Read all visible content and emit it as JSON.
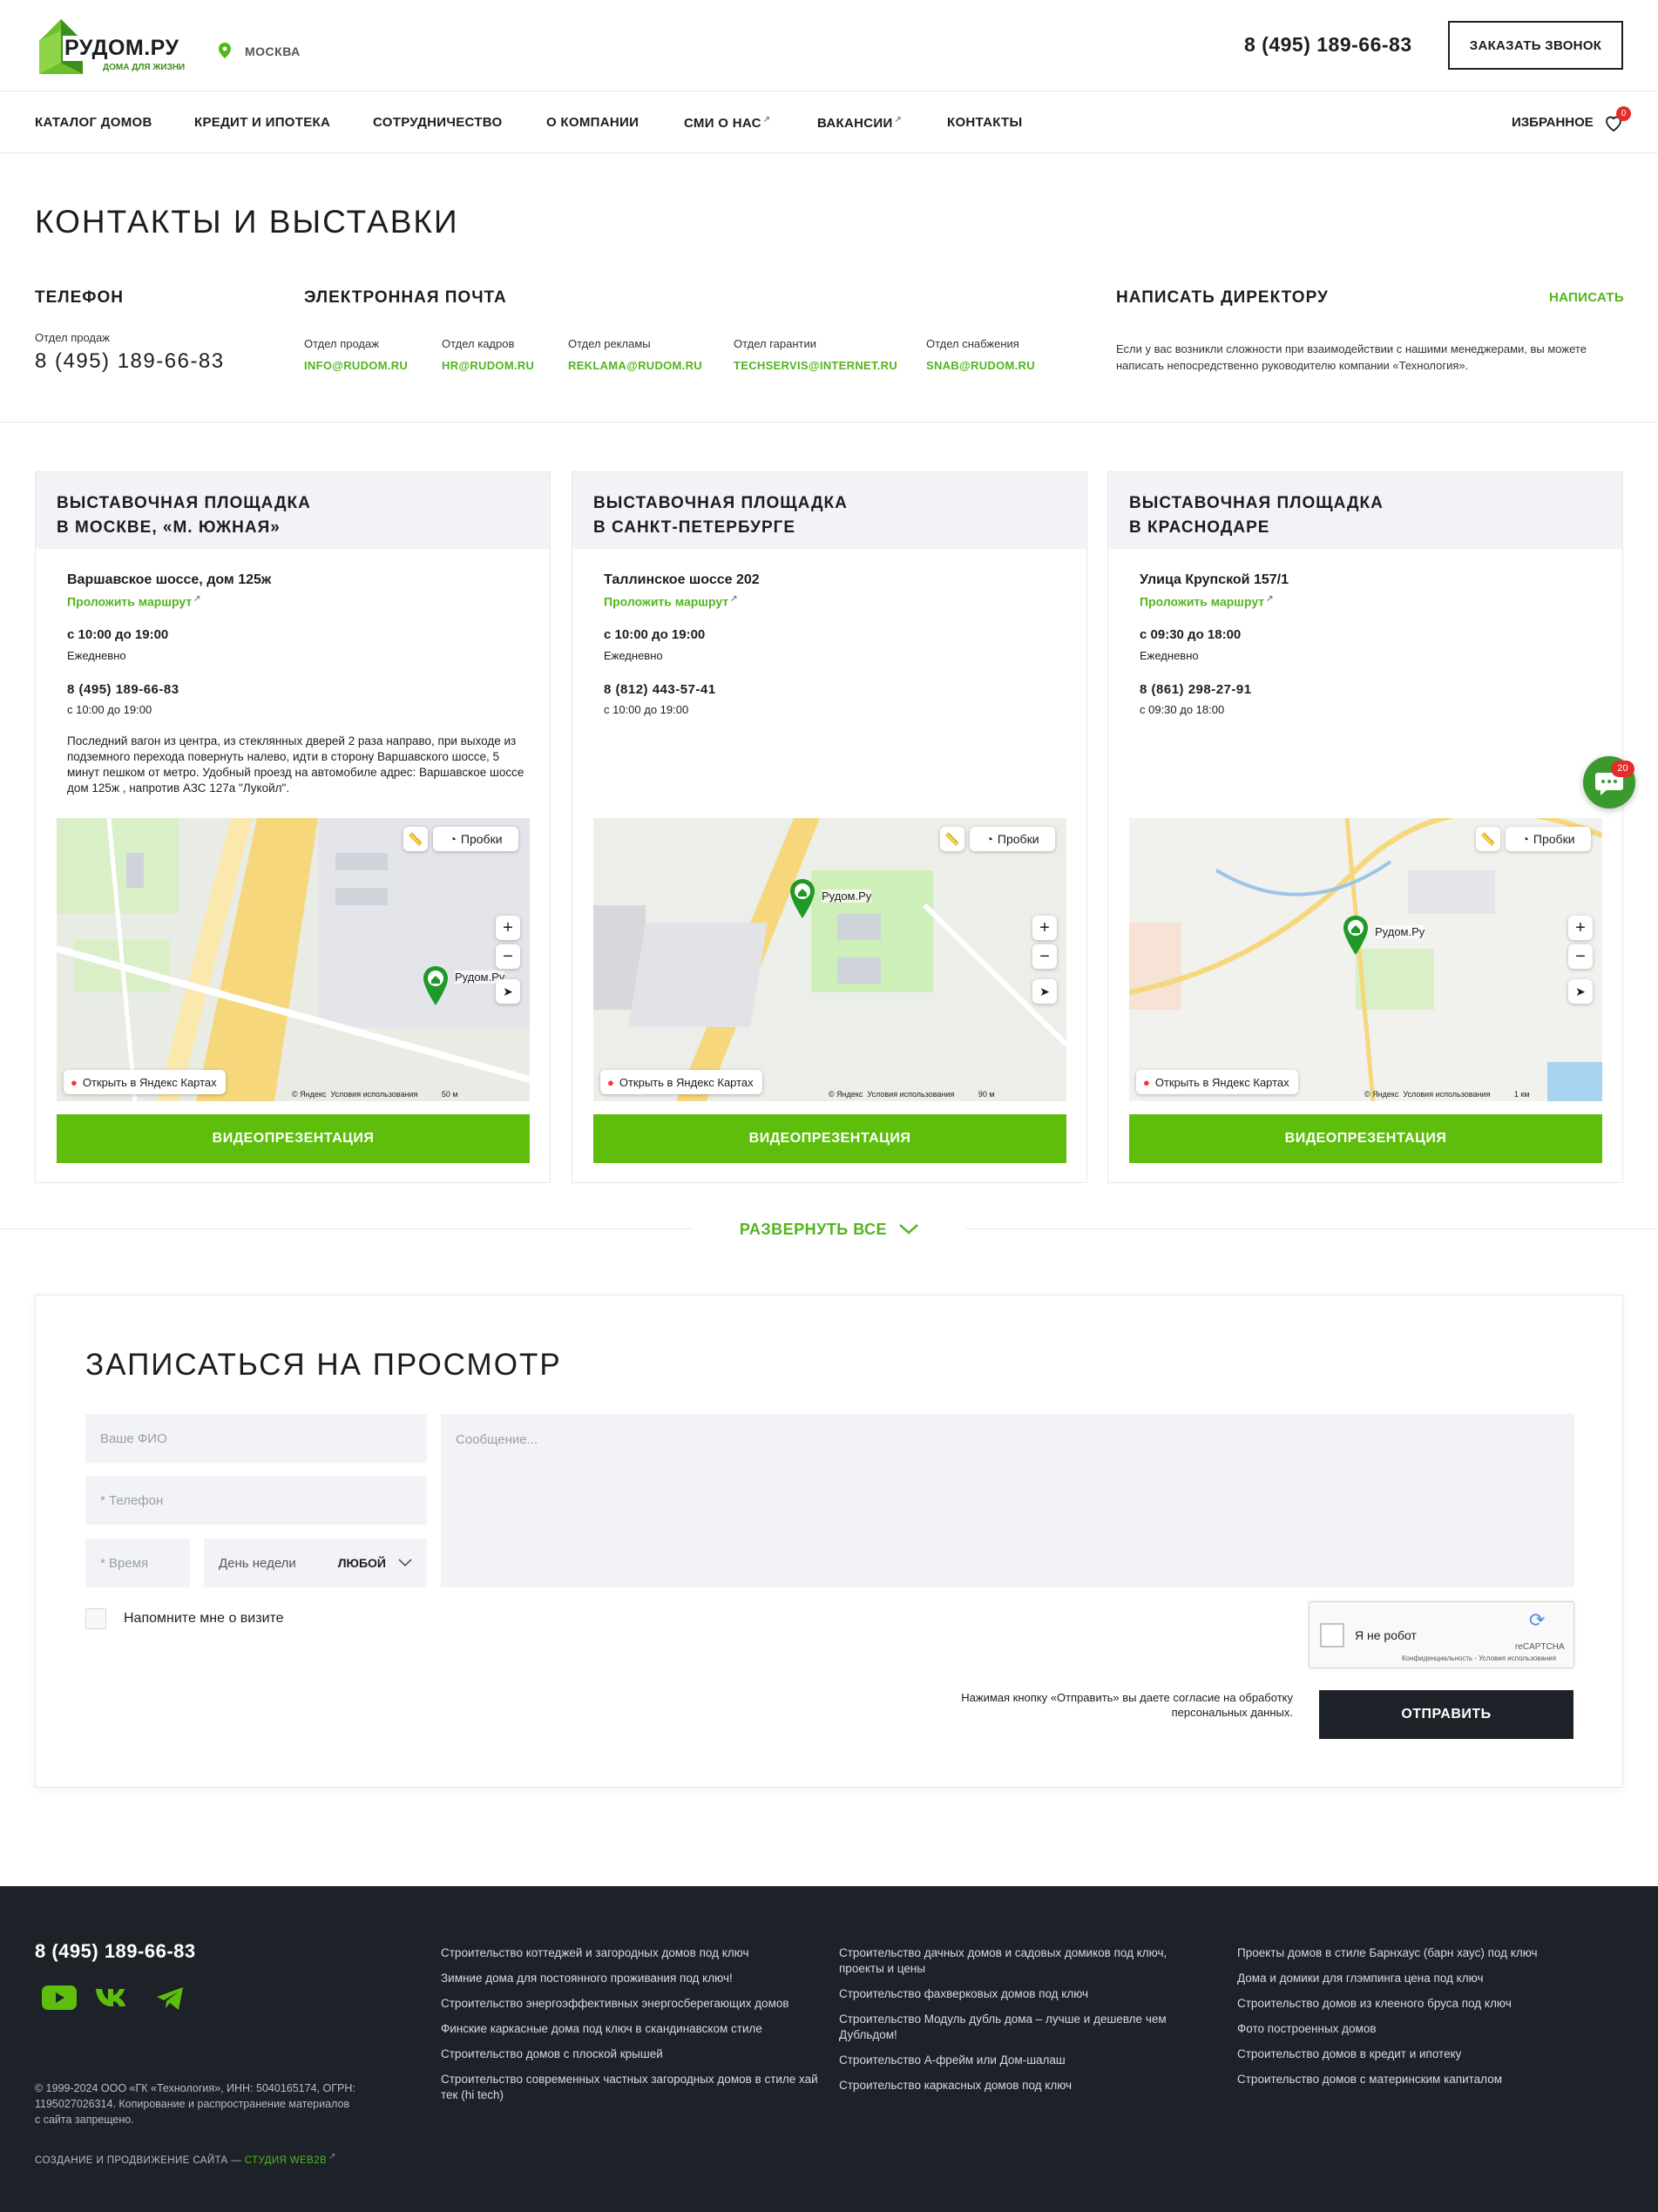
{
  "header": {
    "logo_text": "РУДОМ.РУ",
    "logo_sub": "ДОМА ДЛЯ ЖИЗНИ",
    "city": "МОСКВА",
    "phone": "8 (495) 189-66-83",
    "call_button": "ЗАКАЗАТЬ ЗВОНОК"
  },
  "nav": {
    "items": [
      "КАТАЛОГ ДОМОВ",
      "КРЕДИТ И ИПОТЕКА",
      "СОТРУДНИЧЕСТВО",
      "О КОМПАНИИ",
      "СМИ О НАС",
      "ВАКАНСИИ",
      "КОНТАКТЫ"
    ],
    "favorites": "ИЗБРАННОЕ",
    "fav_count": "0"
  },
  "page_title": "КОНТАКТЫ И ВЫСТАВКИ",
  "contacts": {
    "phone_title": "ТЕЛЕФОН",
    "phone_label": "Отдел продаж",
    "phone": "8 (495) 189-66-83",
    "email_title": "ЭЛЕКТРОННАЯ ПОЧТА",
    "emails": [
      {
        "label": "Отдел продаж",
        "email": "INFO@RUDOM.RU"
      },
      {
        "label": "Отдел кадров",
        "email": "HR@RUDOM.RU"
      },
      {
        "label": "Отдел рекламы",
        "email": "REKLAMA@RUDOM.RU"
      },
      {
        "label": "Отдел гарантии",
        "email": "TECHSERVIS@INTERNET.RU"
      },
      {
        "label": "Отдел снабжения",
        "email": "SNAB@RUDOM.RU"
      }
    ],
    "director_title": "НАПИСАТЬ ДИРЕКТОРУ",
    "director_link": "НАПИСАТЬ",
    "director_text": "Если у вас возникли сложности при взаимодействии с нашими менеджерами, вы можете написать непосредственно руководителю компании «Технология»."
  },
  "exhibitions": [
    {
      "title_l1": "ВЫСТАВОЧНАЯ ПЛОЩАДКА",
      "title_l2": "В МОСКВЕ, «М. ЮЖНАЯ»",
      "address": "Варшавское шоссе, дом 125ж",
      "route": "Проложить маршрут",
      "hours": "с 10:00 до 19:00",
      "days": "Ежедневно",
      "phone": "8 (495) 189-66-83",
      "phone_hours": "с 10:00 до 19:00",
      "description": "Последний вагон из центра, из стеклянных дверей 2 раза направо, при выходе из подземного перехода повернуть налево, идти в сторону Варшавского шоссе, 5 минут пешком от метро. Удобный проезд на автомобиле адрес: Варшавское шоссе дом 125ж , напротив АЗС 127а \"Лукойл\".",
      "map_label": "Рудом.Ру",
      "scale": "50 м",
      "video": "ВИДЕОПРЕЗЕНТАЦИЯ"
    },
    {
      "title_l1": "ВЫСТАВОЧНАЯ ПЛОЩАДКА",
      "title_l2": "В САНКТ-ПЕТЕРБУРГЕ",
      "address": "Таллинское шоссе 202",
      "route": "Проложить маршрут",
      "hours": "с 10:00 до 19:00",
      "days": "Ежедневно",
      "phone": "8 (812) 443-57-41",
      "phone_hours": "с 10:00 до 19:00",
      "description": "",
      "map_label": "Рудом.Ру",
      "scale": "90 м",
      "video": "ВИДЕОПРЕЗЕНТАЦИЯ"
    },
    {
      "title_l1": "ВЫСТАВОЧНАЯ ПЛОЩАДКА",
      "title_l2": "В КРАСНОДАРЕ",
      "address": "Улица Крупской 157/1",
      "route": "Проложить маршрут",
      "hours": "с 09:30 до 18:00",
      "days": "Ежедневно",
      "phone": "8 (861) 298-27-91",
      "phone_hours": "с 09:30 до 18:00",
      "description": "",
      "map_label": "Рудом.Ру",
      "scale": "1 км",
      "video": "ВИДЕОПРЕЗЕНТАЦИЯ"
    }
  ],
  "map_ui": {
    "traffic": "Пробки",
    "open_yandex": "Открыть в Яндекс Картах",
    "copyright": "© Яндекс",
    "terms": "Условия использования"
  },
  "expand": "РАЗВЕРНУТЬ ВСЕ",
  "form": {
    "title": "ЗАПИСАТЬСЯ НА ПРОСМОТР",
    "name_ph": "Ваше ФИО",
    "phone_ph": "* Телефон",
    "time_ph": "* Время",
    "day_label": "День недели",
    "day_value": "ЛЮБОЙ",
    "message_ph": "Сообщение...",
    "remind": "Напомните мне о визите",
    "captcha_label": "Я не робот",
    "captcha_brand": "reCAPTCHA",
    "captcha_terms": "Конфиденциальность - Условия использования",
    "agree": "Нажимая кнопку «Отправить» вы даете согласие на обработку персональных данных.",
    "submit": "ОТПРАВИТЬ"
  },
  "chat": {
    "count": "20"
  },
  "footer": {
    "phone": "8 (495) 189-66-83",
    "col1": [
      "Строительство коттеджей и загородных домов под ключ",
      "Зимние дома для постоянного проживания под ключ!",
      "Строительство энергоэффективных энергосберегающих домов",
      "Финские каркасные дома под ключ в скандинавском стиле",
      "Строительство домов с плоской крышей",
      "Строительство современных частных загородных домов в стиле хай тек (hi tech)"
    ],
    "col2": [
      "Строительство дачных домов и садовых домиков под ключ, проекты и цены",
      "Строительство фахверковых домов под ключ",
      "Строительство Модуль дубль дома – лучше и дешевле чем Дубльдом!",
      "Строительство А-фрейм или Дом-шалаш",
      "Строительство каркасных домов под ключ"
    ],
    "col3": [
      "Проекты домов в стиле Барнхаус (барн хаус) под ключ",
      "Дома и домики для глэмпинга цена под ключ",
      "Строительство домов из клееного бруса под ключ",
      "Фото построенных домов",
      "Строительство домов в кредит и ипотеку",
      "Строительство домов с материнским капиталом"
    ],
    "copyright": "© 1999-2024 ООО «ГК «Технология», ИНН: 5040165174, ОГРН: 1195027026314. Копирование и распространение материалов с сайта запрещено.",
    "studio_text": "СОЗДАНИЕ И ПРОДВИЖЕНИЕ САЙТА — ",
    "studio_link": "СТУДИЯ WEB2B"
  },
  "colors": {
    "accent": "#52b51c",
    "button_green": "#5fbe0c",
    "dark": "#1d2228",
    "badge": "#e52c2c"
  }
}
